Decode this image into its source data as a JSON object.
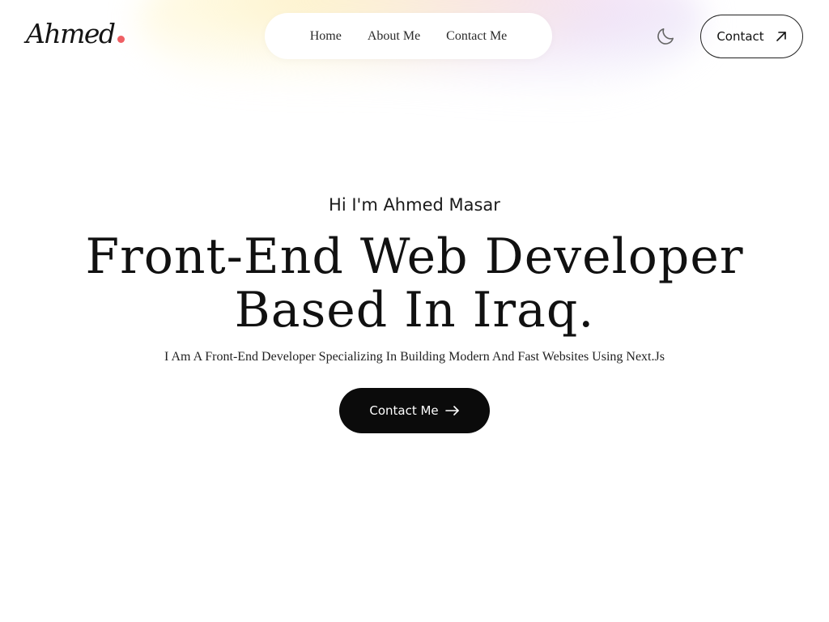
{
  "brand": {
    "logo_text": "Ahmed",
    "dot_color": "#ef5f63"
  },
  "nav": {
    "items": [
      {
        "label": "Home"
      },
      {
        "label": "About Me"
      },
      {
        "label": "Contact Me"
      }
    ]
  },
  "header": {
    "theme_icon": "moon-icon",
    "contact_label": "Contact",
    "contact_icon": "arrow-up-right-icon"
  },
  "hero": {
    "greeting": "Hi I'm Ahmed Masar",
    "headline_line1": "Front-End Web Developer",
    "headline_line2": "Based In Iraq.",
    "tagline": "I Am A Front-End Developer Specializing In Building Modern And Fast Websites Using Next.Js",
    "cta_label": "Contact Me",
    "cta_icon": "arrow-right-icon"
  },
  "colors": {
    "accent": "#ef5f63",
    "button_dark": "#0b0b0b",
    "text": "#111111"
  }
}
